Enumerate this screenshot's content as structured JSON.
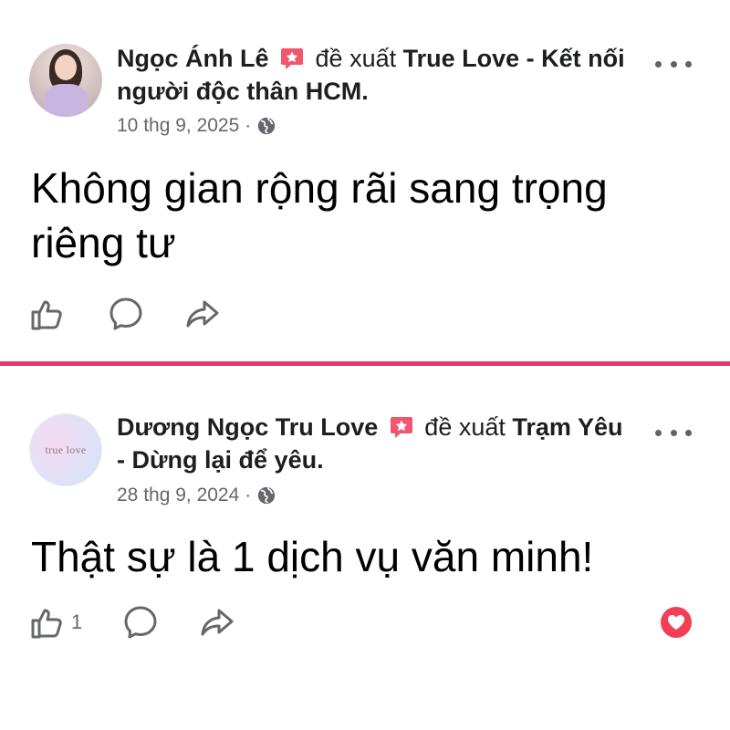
{
  "posts": [
    {
      "author": "Ngọc Ánh Lê",
      "action_text": "đề xuất",
      "page": "True Love - Kết nối người độc thân HCM.",
      "date": "10 thg 9, 2025",
      "separator": "·",
      "content": "Không gian rộng rãi sang trọng riêng tư",
      "like_count": ""
    },
    {
      "author": "Dương Ngọc Tru Love",
      "action_text": "đề xuất",
      "page": "Trạm Yêu - Dừng lại để yêu.",
      "date": "28 thg 9, 2024",
      "separator": "·",
      "avatar_text": "true love",
      "content": "Thật sự là 1 dịch vụ văn minh!",
      "like_count": "1"
    }
  ],
  "icons": {
    "badge": "recommend-badge-icon",
    "privacy": "globe-icon",
    "more": "more-options-icon",
    "like": "like-icon",
    "comment": "comment-icon",
    "share": "share-icon",
    "reaction": "love-reaction-icon"
  },
  "colors": {
    "divider": "#e23a6e",
    "badge": "#f0566e",
    "reaction": "#f33e58",
    "meta_text": "#65676b"
  }
}
